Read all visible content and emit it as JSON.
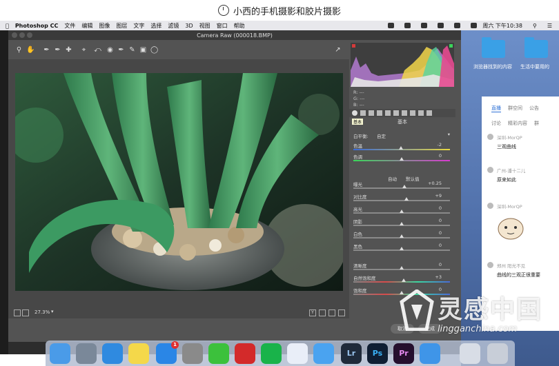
{
  "banner": {
    "title": "小西的手机摄影和胶片摄影"
  },
  "menubar": {
    "app": "Photoshop CC",
    "items": [
      "文件",
      "编辑",
      "图像",
      "图层",
      "文字",
      "选择",
      "滤镜",
      "3D",
      "视图",
      "窗口",
      "帮助"
    ],
    "clock": "周六 下午10:38"
  },
  "camera_raw": {
    "title": "Camera Raw (000018.BMP)",
    "zoom": "27.3%",
    "rgb": [
      "R: ---",
      "G: ---",
      "B: ---"
    ],
    "panel_tab_tooltip": "基本",
    "section_title": "基本",
    "white_balance_label": "白平衡:",
    "white_balance_value": "自定",
    "auto_label": "自动",
    "default_label": "默认值",
    "sliders": [
      {
        "label": "色温",
        "value": "-2",
        "level": 0.49
      },
      {
        "label": "色调",
        "value": "0",
        "level": 0.5
      },
      {
        "label": "曝光",
        "value": "+0.25",
        "level": 0.53
      },
      {
        "label": "对比度",
        "value": "+9",
        "level": 0.55
      },
      {
        "label": "高光",
        "value": "0",
        "level": 0.5
      },
      {
        "label": "阴影",
        "value": "0",
        "level": 0.5
      },
      {
        "label": "白色",
        "value": "0",
        "level": 0.5
      },
      {
        "label": "黑色",
        "value": "0",
        "level": 0.5
      },
      {
        "label": "清晰度",
        "value": "0",
        "level": 0.5
      },
      {
        "label": "自然饱和度",
        "value": "+3",
        "level": 0.52
      },
      {
        "label": "饱和度",
        "value": "0",
        "level": 0.5
      }
    ],
    "cancel": "取消",
    "done": "完成"
  },
  "desktop": {
    "folders": [
      {
        "label": "浏览器找到的内容"
      },
      {
        "label": "生活中要用的"
      }
    ]
  },
  "chat": {
    "tabs": [
      "直播",
      "群空间",
      "公告"
    ],
    "subtabs": [
      "讨论",
      "精彩内容",
      "群"
    ],
    "messages": [
      {
        "who": "深圳-MorQP",
        "text": "三观曲线"
      },
      {
        "who": "广州-潘十二儿",
        "text": "原来如此"
      },
      {
        "who": "深圳-MorQP",
        "text": ""
      },
      {
        "who": "郑州 阳光不见",
        "text": "曲线的三观正很重要"
      }
    ]
  },
  "dock": {
    "badge": "1",
    "labels": [
      "Lr",
      "Ps",
      "Pr"
    ]
  },
  "watermark": {
    "text": "灵感中国",
    "url": "lingganchina.com"
  }
}
